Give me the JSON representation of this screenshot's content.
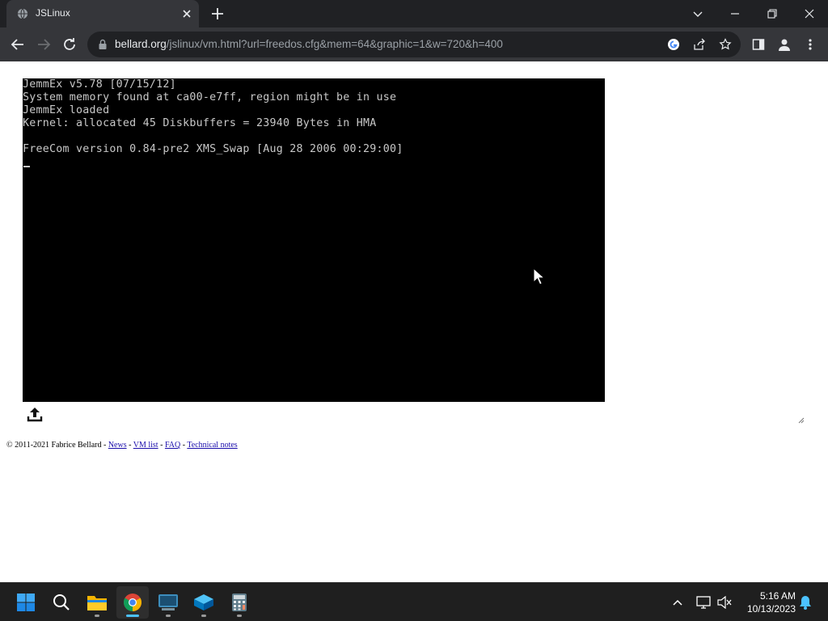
{
  "browser": {
    "tab": {
      "title": "JSLinux"
    },
    "address_bar": {
      "host": "bellard.org",
      "path": "/jslinux/vm.html?url=freedos.cfg&mem=64&graphic=1&w=720&h=400"
    }
  },
  "terminal": {
    "lines": [
      "JemmEx v5.78 [07/15/12]",
      "System memory found at ca00-e7ff, region might be in use",
      "JemmEx loaded",
      "Kernel: allocated 45 Diskbuffers = 23940 Bytes in HMA",
      "",
      "FreeCom version 0.84-pre2 XMS_Swap [Aug 28 2006 00:29:00]"
    ]
  },
  "footer": {
    "copyright": "© 2011-2021 Fabrice Bellard - ",
    "links": [
      "News",
      "VM list",
      "FAQ",
      "Technical notes"
    ],
    "separator": " - "
  },
  "taskbar": {
    "apps": [
      "start-icon",
      "search-icon",
      "file-explorer-icon",
      "chrome-icon",
      "terminal-app-icon",
      "virtualbox-icon",
      "calculator-icon"
    ],
    "clock": {
      "time": "5:16 AM",
      "date": "10/13/2023"
    }
  },
  "colors": {
    "chrome_dark": "#202124",
    "chrome_toolbar": "#35363a",
    "terminal_bg": "#000000",
    "terminal_text": "#c8c8c8",
    "taskbar_bg": "#1f1f1f",
    "accent": "#4cc2ff"
  }
}
